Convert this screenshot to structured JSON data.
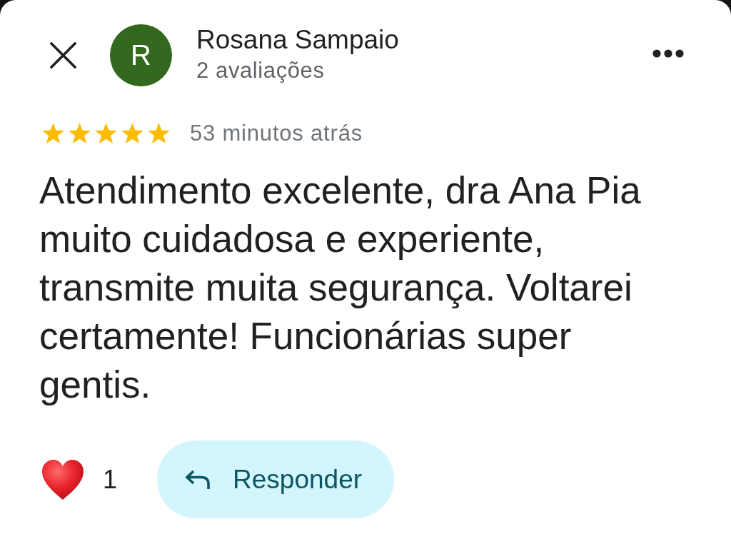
{
  "reviewer": {
    "initial": "R",
    "name": "Rosana Sampaio",
    "review_count": "2 avaliações"
  },
  "review": {
    "stars": 5,
    "time": "53 minutos atrás",
    "text": "Atendimento excelente, dra Ana Pia muito cuidadosa e experiente, transmite muita segurança. Voltarei certamente! Funcionárias super gentis."
  },
  "reactions": {
    "count": "1"
  },
  "reply_button": {
    "label": "Responder"
  }
}
